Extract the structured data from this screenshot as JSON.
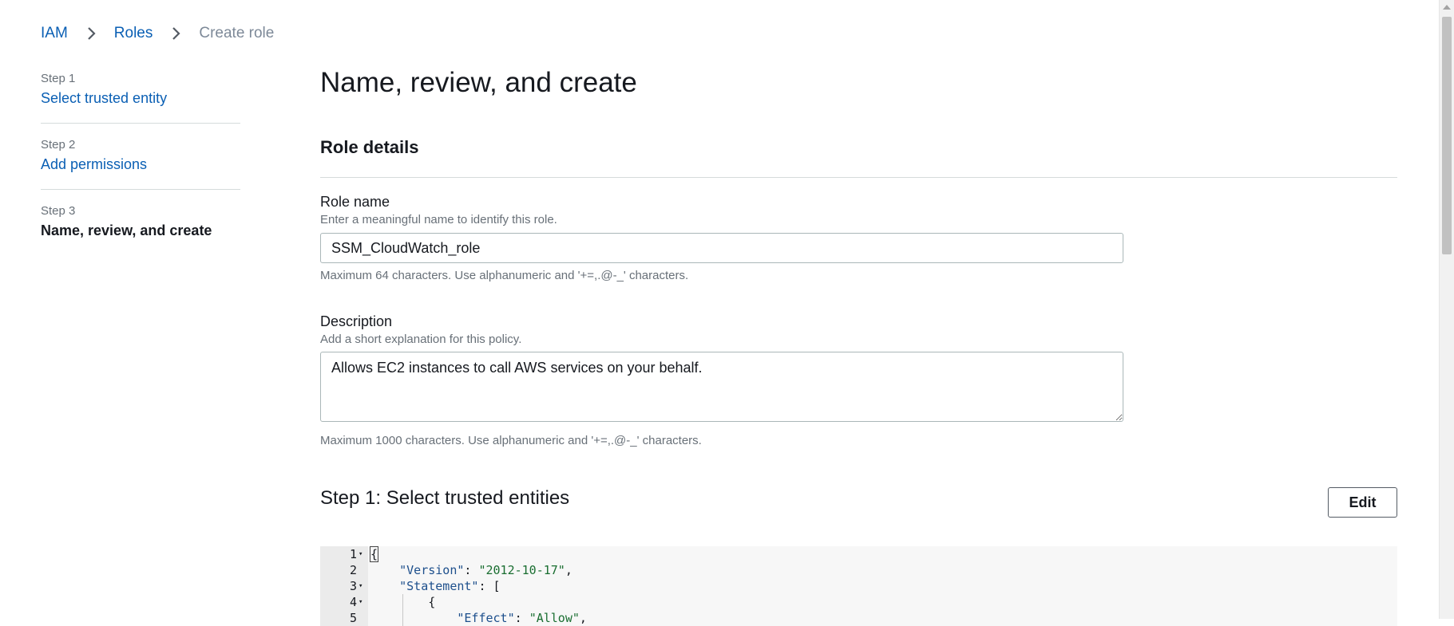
{
  "breadcrumb": {
    "items": [
      {
        "label": "IAM"
      },
      {
        "label": "Roles"
      },
      {
        "label": "Create role"
      }
    ]
  },
  "steps": [
    {
      "num": "Step 1",
      "label": "Select trusted entity"
    },
    {
      "num": "Step 2",
      "label": "Add permissions"
    },
    {
      "num": "Step 3",
      "label": "Name, review, and create"
    }
  ],
  "main": {
    "title": "Name, review, and create",
    "role_details": {
      "title": "Role details",
      "role_name": {
        "label": "Role name",
        "description": "Enter a meaningful name to identify this role.",
        "value": "SSM_CloudWatch_role",
        "constraint": "Maximum 64 characters. Use alphanumeric and '+=,.@-_' characters."
      },
      "description": {
        "label": "Description",
        "description": "Add a short explanation for this policy.",
        "value": "Allows EC2 instances to call AWS services on your behalf.",
        "constraint": "Maximum 1000 characters. Use alphanumeric and '+=,.@-_' characters."
      }
    },
    "trusted_entities": {
      "title": "Step 1: Select trusted entities",
      "edit_label": "Edit",
      "code_lines": [
        {
          "num": "1",
          "fold": "▾"
        },
        {
          "num": "2",
          "fold": ""
        },
        {
          "num": "3",
          "fold": "▾"
        },
        {
          "num": "4",
          "fold": "▾"
        },
        {
          "num": "5",
          "fold": ""
        }
      ],
      "code_text": {
        "open_brace": "{",
        "version_key": "\"Version\"",
        "version_val": "\"2012-10-17\"",
        "statement_key": "\"Statement\"",
        "statement_open": "[",
        "inner_brace": "{",
        "effect_key": "\"Effect\"",
        "effect_val": "\"Allow\"",
        "colon": ": ",
        "comma": ","
      }
    }
  },
  "colors": {
    "link": "#0a5fb4",
    "json_key": "#1d4f8c",
    "json_string": "#1a6e31"
  }
}
